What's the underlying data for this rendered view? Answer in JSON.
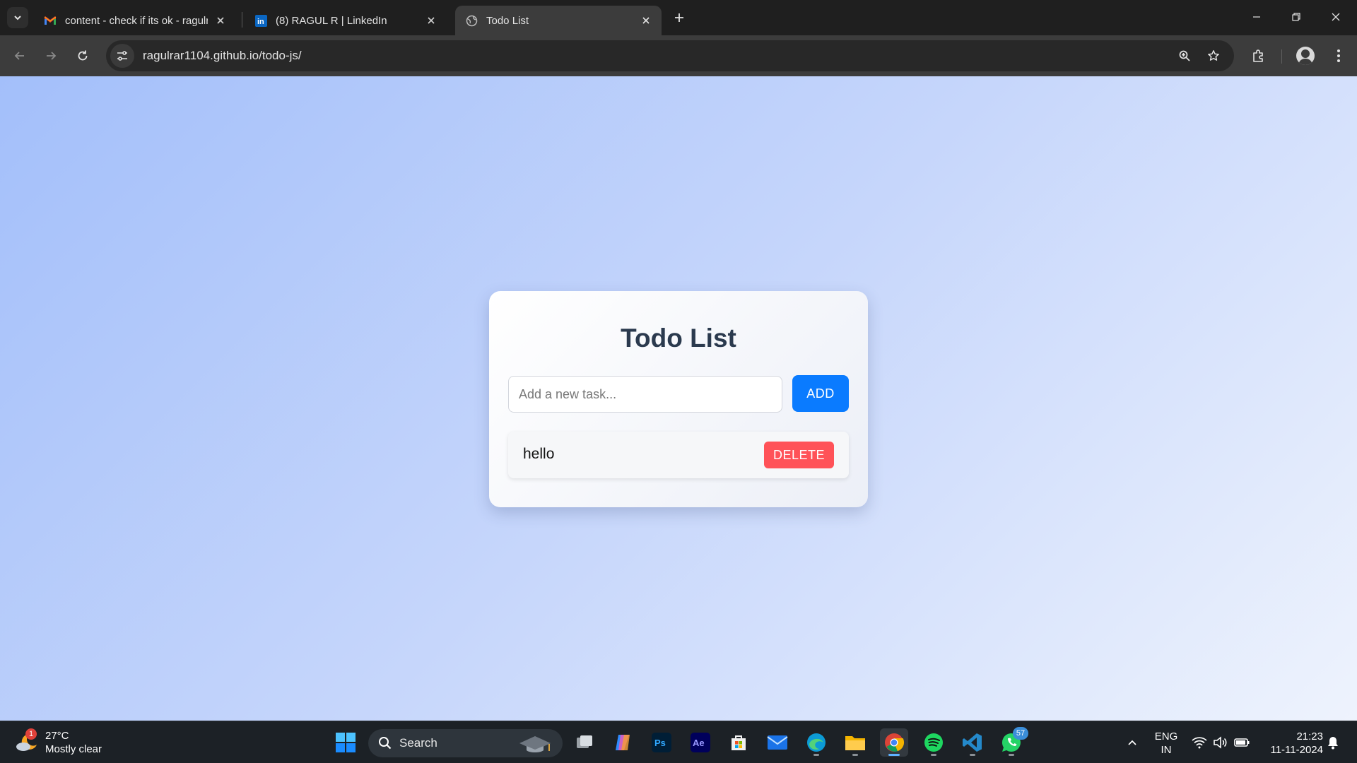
{
  "browser": {
    "tabs": [
      {
        "title": "content - check if its ok - ragulr",
        "favicon": "gmail-icon"
      },
      {
        "title": "(8) RAGUL R | LinkedIn",
        "favicon": "linkedin-icon"
      },
      {
        "title": "Todo List",
        "favicon": "globe-icon"
      }
    ],
    "active_tab": 2,
    "url": "ragulrar1104.github.io/todo-js/"
  },
  "app": {
    "title": "Todo List",
    "input": {
      "placeholder": "Add a new task...",
      "value": ""
    },
    "add_label": "ADD",
    "todos": [
      {
        "text": "hello",
        "delete_label": "DELETE"
      }
    ]
  },
  "taskbar": {
    "weather": {
      "temp": "27°C",
      "condition": "Mostly clear",
      "badge": "1"
    },
    "search_label": "Search",
    "whatsapp_badge": "57",
    "language": {
      "line1": "ENG",
      "line2": "IN"
    },
    "clock": {
      "time": "21:23",
      "date": "11-11-2024"
    }
  },
  "colors": {
    "add_button": "#0a7bff",
    "delete_button": "#ff5258",
    "title_text": "#2b3a4e",
    "page_gradient_start": "#a3bffa",
    "page_gradient_end": "#eef3fd"
  }
}
